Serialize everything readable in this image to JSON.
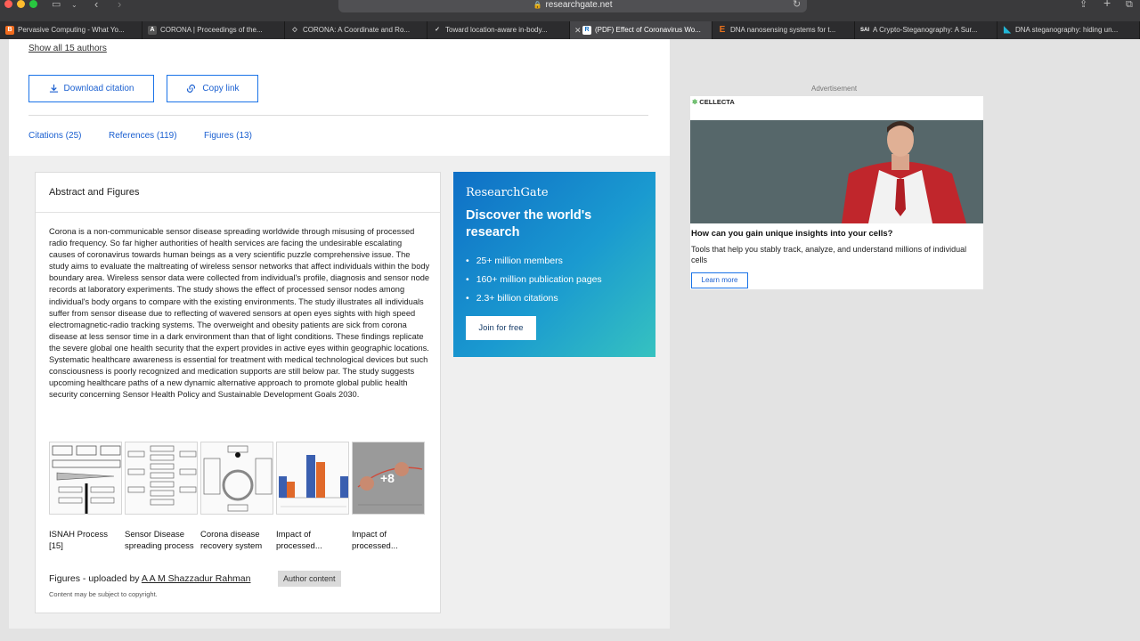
{
  "browser": {
    "url": "researchgate.net",
    "tabs": [
      {
        "title": "Pervasive Computing - What Yo...",
        "favicon": "blogger-icon",
        "color": "#f26b1d",
        "glyph": "B"
      },
      {
        "title": "CORONA | Proceedings of the...",
        "favicon": "acm-icon",
        "color": "#555555",
        "glyph": "A"
      },
      {
        "title": "CORONA: A Coordinate and Ro...",
        "favicon": "diamond-icon",
        "color": "#777777",
        "glyph": "◇"
      },
      {
        "title": "Toward location-aware in-body...",
        "favicon": "check-icon",
        "color": "#555555",
        "glyph": "✓"
      },
      {
        "title": "(PDF) Effect of Coronavirus Wo...",
        "favicon": "researchgate-icon",
        "color": "#ffffff",
        "glyph": "R"
      },
      {
        "title": "DNA nanosensing systems for t...",
        "favicon": "elsevier-icon",
        "color": "#e9711c",
        "glyph": "E"
      },
      {
        "title": "A Crypto-Steganography: A Sur...",
        "favicon": "sai-icon",
        "color": "#2b3f8f",
        "glyph": "SAI"
      },
      {
        "title": "DNA steganography: hiding un...",
        "favicon": "triangle-icon",
        "color": "#22b6d6",
        "glyph": "◣"
      }
    ]
  },
  "header": {
    "show_authors": "Show all 15 authors",
    "download_citation": "Download citation",
    "copy_link": "Copy link",
    "tabs": {
      "citations": "Citations (25)",
      "references": "References (119)",
      "figures": "Figures (13)"
    }
  },
  "abstract": {
    "title": "Abstract and Figures",
    "text": "Corona is a non-communicable sensor disease spreading worldwide through misusing of processed radio frequency. So far higher authorities of health services are facing the undesirable escalating causes of coronavirus towards human beings as a very scientific puzzle comprehensive issue. The study aims to evaluate the maltreating of wireless sensor networks that affect individuals within the body boundary area. Wireless sensor data were collected from individual's profile, diagnosis and sensor node records at laboratory experiments. The study shows the effect of processed sensor nodes among individual's body organs to compare with the existing environments. The study illustrates all individuals suffer from sensor disease due to reflecting of wavered sensors at open eyes sights with high speed electromagnetic-radio tracking systems. The overweight and obesity patients are sick from corona disease at less sensor time in a dark environment than that of light conditions. These findings replicate the severe global one health security that the expert provides in active eyes within geographic locations. Systematic healthcare awareness is essential for treatment with medical technological devices but such consciousness is poorly recognized and medication supports are still below par. The study suggests upcoming healthcare paths of a new dynamic alternative approach to promote global public health security concerning Sensor Health Policy and Sustainable Development Goals 2030.",
    "figures": [
      {
        "caption": "ISNAH Process [15]"
      },
      {
        "caption": "Sensor Disease spreading process"
      },
      {
        "caption": "Corona disease recovery system"
      },
      {
        "caption": "Impact of processed..."
      },
      {
        "caption": "Impact of processed..."
      }
    ],
    "more_count": "+8",
    "uploaded_prefix": "Figures - uploaded by ",
    "uploader": "A A M Shazzadur Rahman",
    "author_badge": "Author content",
    "copyright": "Content may be subject to copyright."
  },
  "promo": {
    "logo": "ResearchGate",
    "headline": "Discover the world's research",
    "bullets": [
      "25+ million members",
      "160+ million publication pages",
      "2.3+ billion citations"
    ],
    "cta": "Join for free"
  },
  "ad": {
    "label": "Advertisement",
    "brand": "CELLECTA",
    "headline": "How can you gain unique insights into your cells?",
    "body": "Tools that help you stably track, analyze, and understand millions of individual cells",
    "cta": "Learn more"
  },
  "colors": {
    "accent": "#1a73e8",
    "promo_start": "#0f6fc6",
    "promo_end": "#36c2c0"
  }
}
